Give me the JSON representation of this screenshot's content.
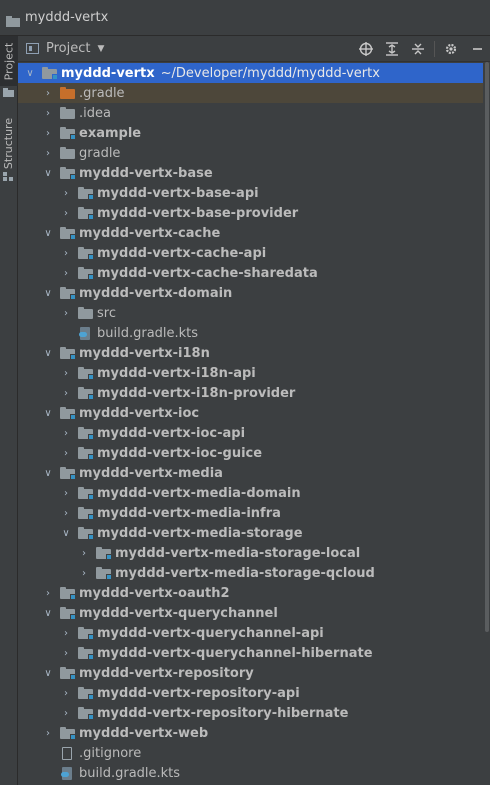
{
  "window": {
    "title": "myddd-vertx"
  },
  "left_strip": {
    "project_label": "Project",
    "structure_label": "Structure"
  },
  "panel": {
    "title": "Project",
    "dropdown_icon": "chevron-down-icon",
    "tools": [
      "locate-icon",
      "expand-all-icon",
      "collapse-all-icon",
      "gear-icon",
      "hide-icon"
    ]
  },
  "tree": {
    "rows": [
      {
        "label": "myddd-vertx",
        "extra": "~/Developer/myddd/myddd-vertx",
        "depth": 0,
        "arrow": "open",
        "icon": "module",
        "bold": true,
        "state": "selected"
      },
      {
        "label": ".gradle",
        "depth": 1,
        "arrow": "closed",
        "icon": "folder-orange",
        "bold": false,
        "state": "highlight"
      },
      {
        "label": ".idea",
        "depth": 1,
        "arrow": "closed",
        "icon": "folder",
        "bold": false
      },
      {
        "label": "example",
        "depth": 1,
        "arrow": "closed",
        "icon": "module",
        "bold": true
      },
      {
        "label": "gradle",
        "depth": 1,
        "arrow": "closed",
        "icon": "folder",
        "bold": false
      },
      {
        "label": "myddd-vertx-base",
        "depth": 1,
        "arrow": "open",
        "icon": "module",
        "bold": true
      },
      {
        "label": "myddd-vertx-base-api",
        "depth": 2,
        "arrow": "closed",
        "icon": "module",
        "bold": true
      },
      {
        "label": "myddd-vertx-base-provider",
        "depth": 2,
        "arrow": "closed",
        "icon": "module",
        "bold": true
      },
      {
        "label": "myddd-vertx-cache",
        "depth": 1,
        "arrow": "open",
        "icon": "module",
        "bold": true
      },
      {
        "label": "myddd-vertx-cache-api",
        "depth": 2,
        "arrow": "closed",
        "icon": "module",
        "bold": true
      },
      {
        "label": "myddd-vertx-cache-sharedata",
        "depth": 2,
        "arrow": "closed",
        "icon": "module",
        "bold": true
      },
      {
        "label": "myddd-vertx-domain",
        "depth": 1,
        "arrow": "open",
        "icon": "module",
        "bold": true
      },
      {
        "label": "src",
        "depth": 2,
        "arrow": "closed",
        "icon": "folder",
        "bold": false
      },
      {
        "label": "build.gradle.kts",
        "depth": 2,
        "arrow": "none",
        "icon": "gradle-file",
        "bold": false
      },
      {
        "label": "myddd-vertx-i18n",
        "depth": 1,
        "arrow": "open",
        "icon": "module",
        "bold": true
      },
      {
        "label": "myddd-vertx-i18n-api",
        "depth": 2,
        "arrow": "closed",
        "icon": "module",
        "bold": true
      },
      {
        "label": "myddd-vertx-i18n-provider",
        "depth": 2,
        "arrow": "closed",
        "icon": "module",
        "bold": true
      },
      {
        "label": "myddd-vertx-ioc",
        "depth": 1,
        "arrow": "open",
        "icon": "module",
        "bold": true
      },
      {
        "label": "myddd-vertx-ioc-api",
        "depth": 2,
        "arrow": "closed",
        "icon": "module",
        "bold": true
      },
      {
        "label": "myddd-vertx-ioc-guice",
        "depth": 2,
        "arrow": "closed",
        "icon": "module",
        "bold": true
      },
      {
        "label": "myddd-vertx-media",
        "depth": 1,
        "arrow": "open",
        "icon": "module",
        "bold": true
      },
      {
        "label": "myddd-vertx-media-domain",
        "depth": 2,
        "arrow": "closed",
        "icon": "module",
        "bold": true
      },
      {
        "label": "myddd-vertx-media-infra",
        "depth": 2,
        "arrow": "closed",
        "icon": "module",
        "bold": true
      },
      {
        "label": "myddd-vertx-media-storage",
        "depth": 2,
        "arrow": "open",
        "icon": "module",
        "bold": true
      },
      {
        "label": "myddd-vertx-media-storage-local",
        "depth": 3,
        "arrow": "closed",
        "icon": "module",
        "bold": true
      },
      {
        "label": "myddd-vertx-media-storage-qcloud",
        "depth": 3,
        "arrow": "closed",
        "icon": "module",
        "bold": true
      },
      {
        "label": "myddd-vertx-oauth2",
        "depth": 1,
        "arrow": "closed",
        "icon": "module",
        "bold": true
      },
      {
        "label": "myddd-vertx-querychannel",
        "depth": 1,
        "arrow": "open",
        "icon": "module",
        "bold": true
      },
      {
        "label": "myddd-vertx-querychannel-api",
        "depth": 2,
        "arrow": "closed",
        "icon": "module",
        "bold": true
      },
      {
        "label": "myddd-vertx-querychannel-hibernate",
        "depth": 2,
        "arrow": "closed",
        "icon": "module",
        "bold": true
      },
      {
        "label": "myddd-vertx-repository",
        "depth": 1,
        "arrow": "open",
        "icon": "module",
        "bold": true
      },
      {
        "label": "myddd-vertx-repository-api",
        "depth": 2,
        "arrow": "closed",
        "icon": "module",
        "bold": true
      },
      {
        "label": "myddd-vertx-repository-hibernate",
        "depth": 2,
        "arrow": "closed",
        "icon": "module",
        "bold": true
      },
      {
        "label": "myddd-vertx-web",
        "depth": 1,
        "arrow": "closed",
        "icon": "module",
        "bold": true
      },
      {
        "label": ".gitignore",
        "depth": 1,
        "arrow": "none",
        "icon": "file",
        "bold": false
      },
      {
        "label": "build.gradle.kts",
        "depth": 1,
        "arrow": "none",
        "icon": "gradle-file",
        "bold": false
      }
    ]
  },
  "colors": {
    "background": "#3c3f41",
    "selection": "#2f65ca",
    "highlight": "#4d473a",
    "module_marker": "#3592c4",
    "folder_orange": "#c66f2b"
  }
}
